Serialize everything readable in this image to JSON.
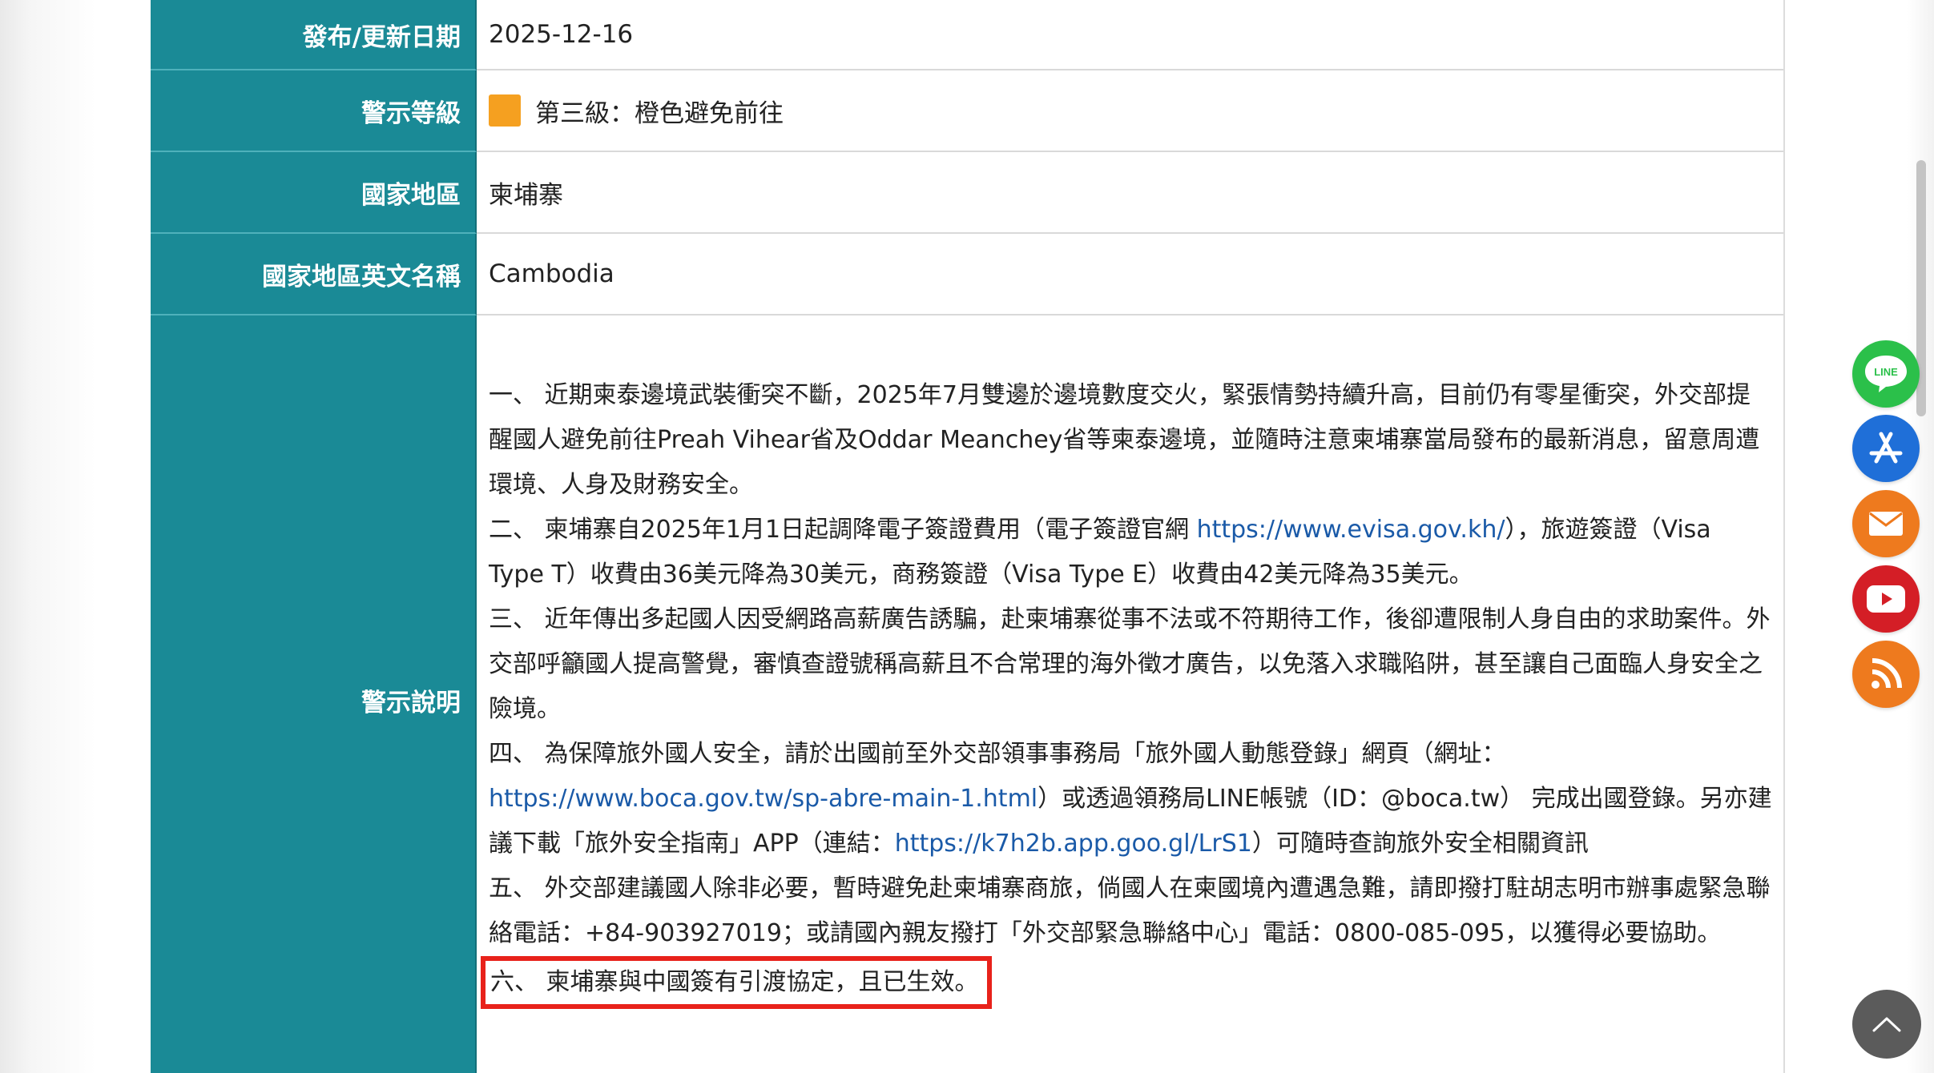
{
  "rows": {
    "date": {
      "label": "發布/更新日期",
      "value": "2025-12-16"
    },
    "level": {
      "label": "警示等級",
      "value": "第三級：橙色避免前往",
      "color": "#f5a020"
    },
    "country": {
      "label": "國家地區",
      "value": "柬埔寨"
    },
    "country_en": {
      "label": "國家地區英文名稱",
      "value": "Cambodia"
    },
    "description": {
      "label": "警示說明",
      "p1": "一、 近期柬泰邊境武裝衝突不斷，2025年7月雙邊於邊境數度交火，緊張情勢持續升高，目前仍有零星衝突，外交部提醒國人避免前往Preah Vihear省及Oddar Meanchey省等柬泰邊境，並隨時注意柬埔寨當局發布的最新消息，留意周遭環境、人身及財務安全。",
      "p2_a": "二、 柬埔寨自2025年1月1日起調降電子簽證費用（電子簽證官網 ",
      "p2_link": "https://www.evisa.gov.kh/",
      "p2_b": "），旅遊簽證（Visa Type T）收費由36美元降為30美元，商務簽證（Visa Type E）收費由42美元降為35美元。",
      "p3": "三、 近年傳出多起國人因受網路高薪廣告誘騙，赴柬埔寨從事不法或不符期待工作，後卻遭限制人身自由的求助案件。外交部呼籲國人提高警覺，審慎查證號稱高薪且不合常理的海外徵才廣告，以免落入求職陷阱，甚至讓自己面臨人身安全之險境。",
      "p4_a": "四、 為保障旅外國人安全，請於出國前至外交部領事事務局「旅外國人動態登錄」網頁（網址：",
      "p4_link1": "https://www.boca.gov.tw/sp-abre-main-1.html",
      "p4_b": "）或透過領務局LINE帳號（ID：@boca.tw） 完成出國登錄。另亦建議下載「旅外安全指南」APP（連結：",
      "p4_link2": "https://k7h2b.app.goo.gl/LrS1",
      "p4_c": "）可隨時查詢旅外安全相關資訊",
      "p5": "五、 外交部建議國人除非必要，暫時避免赴柬埔寨商旅，倘國人在柬國境內遭遇急難，請即撥打駐胡志明市辦事處緊急聯絡電話：+84-903927019；或請國內親友撥打「外交部緊急聯絡中心」電話：0800-085-095，以獲得必要協助。",
      "p6": "六、 柬埔寨與中國簽有引渡協定，且已生效。"
    }
  },
  "floating": {
    "line_label": "LINE",
    "colors": {
      "line": "#2bc04a",
      "app": "#1f6fd8",
      "mail": "#ee7a1e",
      "youtube": "#d41e26",
      "rss": "#ee7a1e"
    },
    "icons": [
      "line-icon",
      "app-store-icon",
      "mail-icon",
      "youtube-icon",
      "rss-icon",
      "chevron-up-icon"
    ]
  },
  "colors": {
    "label_bg": "#1a8a96",
    "link": "#1a5aa8",
    "highlight_border": "#e8221b"
  }
}
